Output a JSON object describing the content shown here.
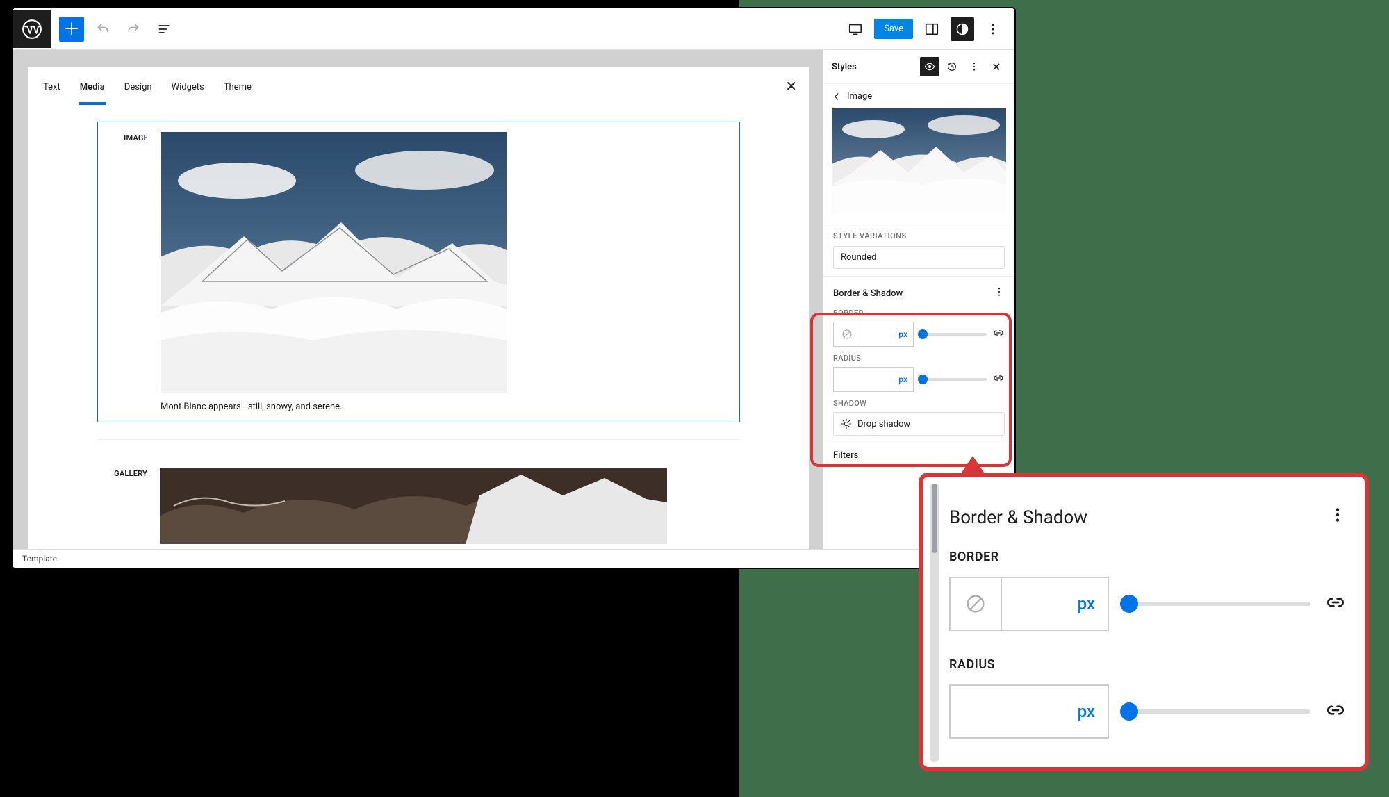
{
  "topbar": {
    "save_label": "Save"
  },
  "canvas": {
    "tabs": [
      "Text",
      "Media",
      "Design",
      "Widgets",
      "Theme"
    ],
    "active_tab": 1,
    "image_block_label": "IMAGE",
    "gallery_block_label": "GALLERY",
    "caption": "Mont Blanc appears—still, snowy, and serene."
  },
  "sidebar": {
    "title": "Styles",
    "breadcrumb": "Image",
    "style_variations_label": "STYLE VARIATIONS",
    "rounded_label": "Rounded",
    "border_shadow": {
      "title": "Border & Shadow",
      "border_label": "BORDER",
      "radius_label": "RADIUS",
      "unit": "px",
      "shadow_label": "SHADOW",
      "drop_shadow": "Drop shadow"
    },
    "filters_label": "Filters"
  },
  "footer": {
    "template": "Template"
  },
  "callout": {
    "title": "Border & Shadow",
    "border_label": "BORDER",
    "radius_label": "RADIUS",
    "unit": "px"
  }
}
